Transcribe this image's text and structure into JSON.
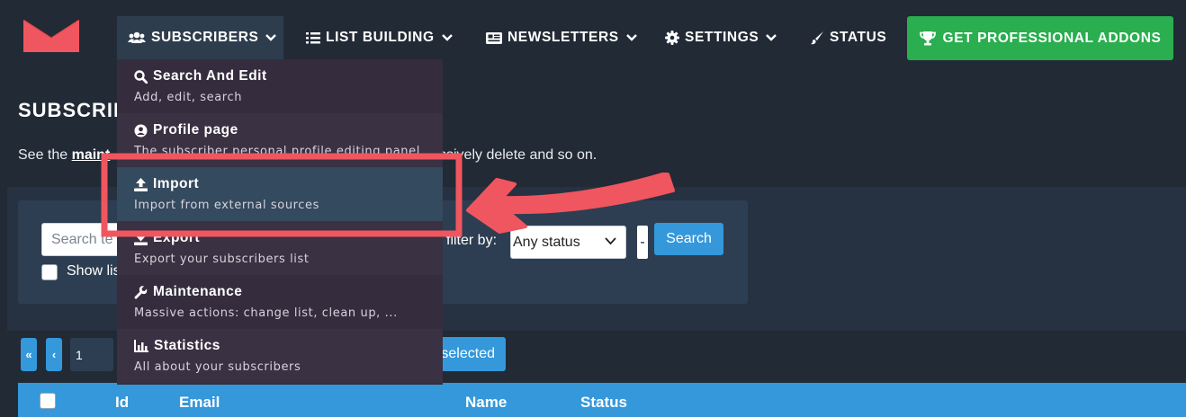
{
  "colors": {
    "background": "#222a35",
    "nav_active": "#2e3d4e",
    "pro_button": "#2aae4f",
    "primary_blue": "#3498db",
    "dropdown_bg": "#352d3e",
    "dropdown_highlight": "#344a5e",
    "annotation_red": "#f0565f",
    "logo_red": "#f0565f"
  },
  "nav": {
    "items": [
      {
        "label": "SUBSCRIBERS",
        "icon": "users-icon",
        "has_dropdown": true,
        "active": true
      },
      {
        "label": "LIST BUILDING",
        "icon": "list-icon",
        "has_dropdown": true
      },
      {
        "label": "NEWSLETTERS",
        "icon": "newspaper-icon",
        "has_dropdown": true
      },
      {
        "label": "SETTINGS",
        "icon": "gear-icon",
        "has_dropdown": true
      },
      {
        "label": "STATUS",
        "icon": "brush-icon",
        "has_dropdown": false
      }
    ],
    "pro_button": {
      "label": "GET PROFESSIONAL ADDONS",
      "icon": "trophy-icon"
    }
  },
  "dropdown": {
    "items": [
      {
        "title": "Search And Edit",
        "desc": "Add, edit, search",
        "icon": "search-icon"
      },
      {
        "title": "Profile page",
        "desc": "The subscriber personal profile editing panel",
        "icon": "user-circle-icon"
      },
      {
        "title": "Import",
        "desc": "Import from external sources",
        "icon": "upload-icon",
        "highlighted": true
      },
      {
        "title": "Export",
        "desc": "Export your subscribers list",
        "icon": "download-icon"
      },
      {
        "title": "Maintenance",
        "desc": "Massive actions: change list, clean up, ...",
        "icon": "wrench-icon"
      },
      {
        "title": "Statistics",
        "desc": "All about your subscribers",
        "icon": "chart-icon"
      }
    ]
  },
  "page": {
    "title": "SUBSCRIB",
    "intro_prefix": "See the ",
    "intro_link": "maint",
    "intro_tail": "ssively delete and so on."
  },
  "filters": {
    "search_placeholder": "Search te",
    "show_label": "Show lis",
    "filter_label": "filter by:",
    "status_value": "Any status",
    "dash": "-",
    "search_button": "Search"
  },
  "pagination": {
    "first": "«",
    "prev": "‹",
    "page": "1",
    "selected_button": "selected"
  },
  "table": {
    "columns": [
      "Id",
      "Email",
      "Name",
      "Status"
    ]
  }
}
